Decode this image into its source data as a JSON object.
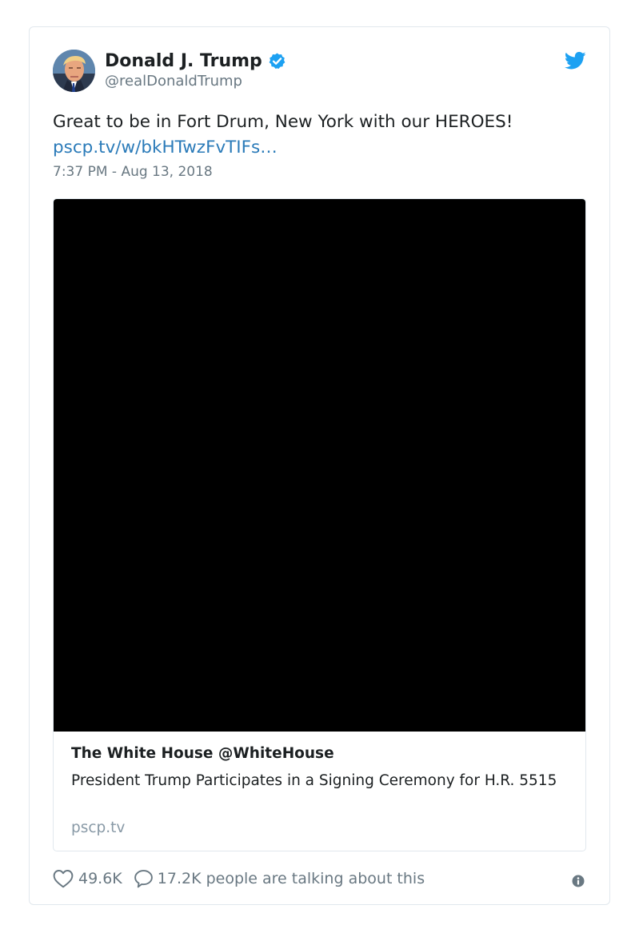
{
  "author": {
    "display_name": "Donald J. Trump",
    "handle": "@realDonaldTrump",
    "verified": true,
    "verified_color": "#1da1f2"
  },
  "tweet": {
    "text": "Great to be in Fort Drum, New York with our HEROES!",
    "link_text": "pscp.tv/w/bkHTwzFvTIFs…",
    "timestamp": "7:37 PM - Aug 13, 2018"
  },
  "media_card": {
    "title": "The White House @WhiteHouse",
    "description": "President Trump Participates in a Signing Ceremony for H.R. 5515",
    "domain": "pscp.tv"
  },
  "actions": {
    "like_count": "49.6K",
    "reply_text": "17.2K people are talking about this"
  },
  "icons": {
    "brand": "twitter-bird-icon",
    "verified": "verified-badge-icon",
    "like": "heart-icon",
    "reply": "speech-bubble-icon",
    "info": "info-icon"
  },
  "colors": {
    "brand_blue": "#1da1f2",
    "link_blue": "#2b7bb9",
    "text": "#1c2022",
    "muted": "#697882",
    "border": "#e1e8ed"
  }
}
